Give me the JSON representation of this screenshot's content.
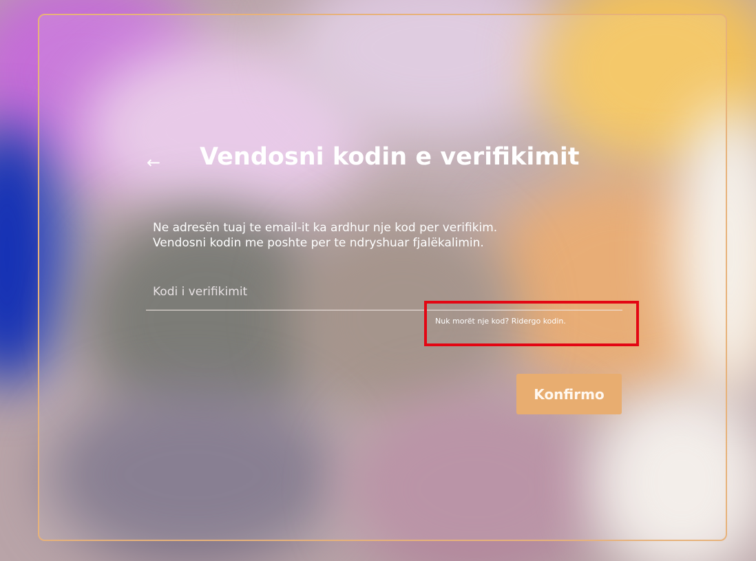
{
  "colors": {
    "accent": "#e8ad70",
    "card_border": "#e7b27a",
    "highlight_box": "#e30613",
    "text": "#ffffff"
  },
  "header": {
    "back_icon": "arrow-left-icon",
    "back_glyph": "←",
    "title": "Vendosni kodin e verifikimit"
  },
  "description": {
    "line1": "Ne adresën tuaj te email-it ka ardhur nje kod per verifikim.",
    "line2": "Vendosni kodin me poshte per te ndryshuar fjalëkalimin."
  },
  "form": {
    "code_placeholder": "Kodi i verifikimit",
    "code_value": "",
    "resend_prompt": "Nuk morët nje kod?",
    "resend_link": "Ridergo kodin.",
    "confirm_label": "Konfirmo"
  }
}
